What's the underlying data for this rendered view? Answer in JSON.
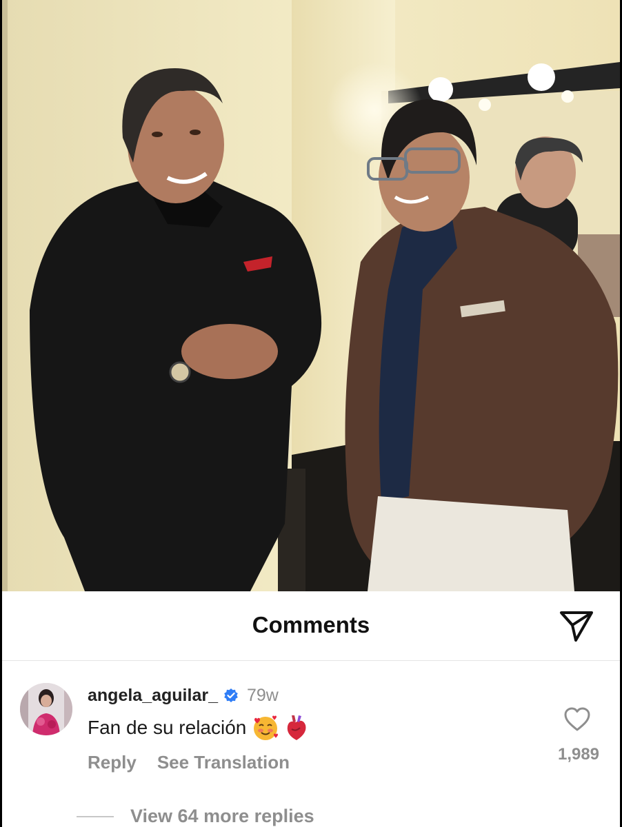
{
  "comments_sheet": {
    "title": "Comments",
    "share_icon": "paper-plane-icon"
  },
  "comment": {
    "username": "angela_aguilar_",
    "verified": true,
    "verified_color": "#2f7df6",
    "timestamp": "79w",
    "text": "Fan de su relación",
    "emojis": [
      "smiling-face-with-hearts-emoji",
      "anatomical-heart-emoji"
    ],
    "reply_label": "Reply",
    "translate_label": "See Translation",
    "like_count": "1,989",
    "like_icon": "heart-outline-icon",
    "view_replies_label": "View 64 more replies"
  }
}
